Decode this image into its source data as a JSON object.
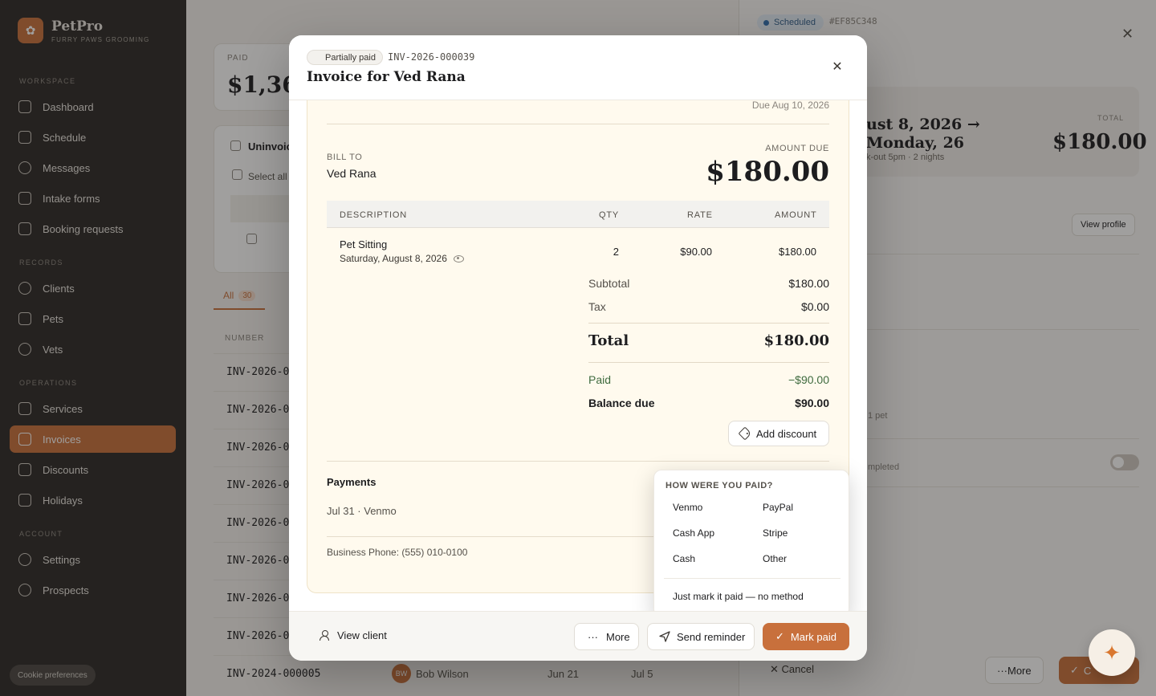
{
  "brand": {
    "name": "PetPro",
    "tagline": "FURRY PAWS GROOMING"
  },
  "sidebar": {
    "sections": {
      "workspace": "WORKSPACE",
      "records": "RECORDS",
      "operations": "OPERATIONS",
      "account": "ACCOUNT"
    },
    "items": {
      "dashboard": "Dashboard",
      "schedule": "Schedule",
      "messages": "Messages",
      "intake": "Intake forms",
      "booking": "Booking requests",
      "clients": "Clients",
      "pets": "Pets",
      "vets": "Vets",
      "services": "Services",
      "invoices": "Invoices",
      "discounts": "Discounts",
      "holidays": "Holidays",
      "settings": "Settings",
      "prospects": "Prospects"
    },
    "cookie_button": "Cookie preferences"
  },
  "background": {
    "stat_label": "PAID",
    "stat_value": "$1,360",
    "panel_title": "Uninvoiced",
    "select_all": "Select all",
    "tab_all": "All",
    "tab_all_count": "30",
    "col_number": "NUMBER",
    "rows": [
      {
        "number": "INV-2026-0"
      },
      {
        "number": "INV-2026-0"
      },
      {
        "number": "INV-2026-0"
      },
      {
        "number": "INV-2026-0"
      },
      {
        "number": "INV-2026-0"
      },
      {
        "number": "INV-2026-0"
      },
      {
        "number": "INV-2026-0"
      },
      {
        "number": "INV-2026-0"
      }
    ],
    "last_row": {
      "number": "INV-2024-000005",
      "avatar": "BW",
      "client": "Bob Wilson",
      "date1": "Jun 21",
      "date2": "Jul 5"
    }
  },
  "drawer": {
    "status": "Scheduled",
    "id": "#EF85C348",
    "dates": "ust 8, 2026 → Monday, 26",
    "sub": "k-out 5pm · 2 nights",
    "total_label": "TOTAL",
    "total_value": "$180.00",
    "view_profile": "View profile",
    "pet_note": "1 pet",
    "completed_note": "mpleted",
    "cancel": "Cancel",
    "more": "More",
    "confirm": "C"
  },
  "modal": {
    "status_badge": "Partially paid",
    "invoice_number": "INV-2026-000039",
    "title": "Invoice for Ved Rana",
    "due_date": "Due Aug 10, 2026",
    "bill_to_label": "BILL TO",
    "bill_to_name": "Ved Rana",
    "amount_due_label": "AMOUNT DUE",
    "amount_due": "$180.00",
    "columns": {
      "description": "DESCRIPTION",
      "qty": "QTY",
      "rate": "RATE",
      "amount": "AMOUNT"
    },
    "line_items": [
      {
        "name": "Pet Sitting",
        "date": "Saturday, August 8, 2026",
        "qty": "2",
        "rate": "$90.00",
        "amount": "$180.00"
      }
    ],
    "totals": {
      "subtotal_label": "Subtotal",
      "subtotal": "$180.00",
      "tax_label": "Tax",
      "tax": "$0.00",
      "total_label": "Total",
      "total": "$180.00",
      "paid_label": "Paid",
      "paid": "−$90.00",
      "balance_label": "Balance due",
      "balance": "$90.00"
    },
    "add_discount": "Add discount",
    "payments_title": "Payments",
    "payments": [
      {
        "summary": "Jul 31 · Venmo"
      }
    ],
    "business_phone": "Business Phone: (555) 010-0100",
    "popover": {
      "title": "HOW WERE YOU PAID?",
      "options": [
        "Venmo",
        "PayPal",
        "Cash App",
        "Stripe",
        "Cash",
        "Other"
      ],
      "no_method": "Just mark it paid — no method"
    },
    "footer": {
      "view_client": "View client",
      "more": "More",
      "send_reminder": "Send reminder",
      "mark_paid": "Mark paid"
    }
  },
  "colors": {
    "accent": "#c8703c",
    "paid_green": "#3f6b3f"
  }
}
